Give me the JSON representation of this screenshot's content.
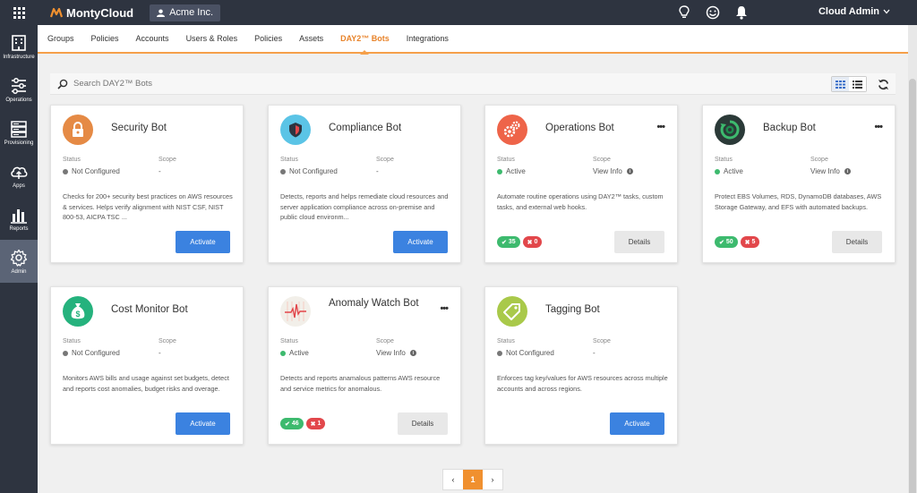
{
  "header": {
    "brand": "MontyCloud",
    "org": "Acme Inc.",
    "user": "Cloud Admin",
    "icons": [
      "bulb-icon",
      "smiley-icon",
      "bell-icon"
    ]
  },
  "sidebar": {
    "items": [
      {
        "label": "Infrastructure",
        "icon": "building-icon"
      },
      {
        "label": "Operations",
        "icon": "sliders-icon"
      },
      {
        "label": "Provisioning",
        "icon": "server-icon"
      },
      {
        "label": "Apps",
        "icon": "cloud-upload-icon"
      },
      {
        "label": "Reports",
        "icon": "bar-chart-icon"
      },
      {
        "label": "Admin",
        "icon": "gear-icon",
        "active": true
      }
    ]
  },
  "tabs": [
    {
      "label": "Groups"
    },
    {
      "label": "Policies"
    },
    {
      "label": "Accounts"
    },
    {
      "label": "Users & Roles"
    },
    {
      "label": "Policies"
    },
    {
      "label": "Assets"
    },
    {
      "label": "DAY2™ Bots",
      "active": true
    },
    {
      "label": "Integrations"
    }
  ],
  "search": {
    "placeholder": "Search DAY2™ Bots"
  },
  "labels": {
    "status": "Status",
    "scope": "Scope"
  },
  "cards": [
    {
      "title": "Security Bot",
      "status": "Not Configured",
      "scope": "-",
      "description": "Checks for 200+ security best practices on AWS resources & services. Helps verify alignment with NIST CSF, NIST 800-53, AICPA TSC ...",
      "action": "Activate",
      "icon": "padlock-icon",
      "icon_color": "#e58a45"
    },
    {
      "title": "Compliance Bot",
      "status": "Not Configured",
      "scope": "-",
      "description": "Detects, reports and helps remediate cloud resources and server application compliance across on-premise and public cloud environm...",
      "action": "Activate",
      "icon": "shield-icon",
      "icon_color": "#5bc4e6"
    },
    {
      "title": "Operations Bot",
      "status": "Active",
      "scope": "View Info",
      "description": "Automate routine operations using DAY2™ tasks, custom tasks, and external web hooks.",
      "action": "Details",
      "pass": "35",
      "fail": "0",
      "icon": "gears-icon",
      "icon_color": "#ee6449"
    },
    {
      "title": "Backup Bot",
      "status": "Active",
      "scope": "View Info",
      "description": "Protect EBS Volumes, RDS, DynamoDB databases, AWS Storage Gateway, and EFS with automated backups.",
      "action": "Details",
      "pass": "50",
      "fail": "5",
      "icon": "backup-icon",
      "icon_color": "#2b3a38"
    },
    {
      "title": "Cost Monitor Bot",
      "status": "Not Configured",
      "scope": "-",
      "description": "Monitors AWS bills and usage against set budgets, detect and reports cost anomalies, budget risks and overage.",
      "action": "Activate",
      "icon": "money-bag-icon",
      "icon_color": "#25b27d"
    },
    {
      "title": "Anomaly Watch Bot",
      "status": "Active",
      "scope": "View Info",
      "description": "Detects and reports anamalous patterns AWS resource and service metrics for anomalous.",
      "action": "Details",
      "pass": "46",
      "fail": "1",
      "icon": "pulse-icon",
      "icon_color": "#f2efe9"
    },
    {
      "title": "Tagging Bot",
      "status": "Not Configured",
      "scope": "-",
      "description": "Enforces tag key/values for AWS resources across multiple accounts and across regions.",
      "action": "Activate",
      "icon": "tag-icon",
      "icon_color": "#a9c94a"
    }
  ],
  "pagination": {
    "prev": "‹",
    "current": "1",
    "next": "›"
  },
  "colors": {
    "accent": "#f0902f",
    "primary_button": "#3b82e0",
    "active_status": "#3dba6e",
    "inactive_status": "#777777",
    "nav_bg": "#2e3440"
  }
}
